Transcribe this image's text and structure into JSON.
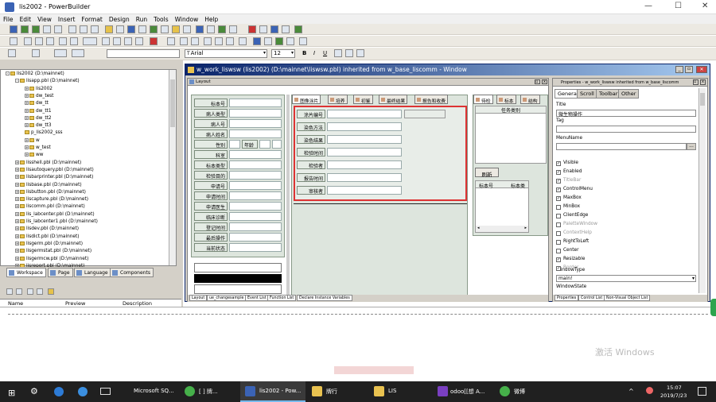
{
  "app": {
    "title": "lis2002 - PowerBuilder"
  },
  "menu": [
    "File",
    "Edit",
    "View",
    "Insert",
    "Format",
    "Design",
    "Run",
    "Tools",
    "Window",
    "Help"
  ],
  "font": {
    "name": "Arial",
    "size": "12",
    "bold": "B",
    "italic": "I",
    "underline": "U"
  },
  "tree": {
    "nodes": [
      {
        "label": "lis2002 (D:\\mainnet)",
        "depth": 0,
        "expand": "-"
      },
      {
        "label": "lisapp.pbl (D:\\mainnet)",
        "depth": 1,
        "expand": "-"
      },
      {
        "label": "lis2002",
        "depth": 2,
        "expand": "+"
      },
      {
        "label": "dw_test",
        "depth": 2,
        "expand": "+"
      },
      {
        "label": "dw_tt",
        "depth": 2,
        "expand": "+"
      },
      {
        "label": "dw_tt1",
        "depth": 2,
        "expand": "+"
      },
      {
        "label": "dw_tt2",
        "depth": 2,
        "expand": "+"
      },
      {
        "label": "dw_tt3",
        "depth": 2,
        "expand": "+"
      },
      {
        "label": "p_lis2002_sss",
        "depth": 2,
        "expand": ""
      },
      {
        "label": "w",
        "depth": 2,
        "expand": "+"
      },
      {
        "label": "w_test",
        "depth": 2,
        "expand": "+"
      },
      {
        "label": "ww",
        "depth": 2,
        "expand": "+"
      },
      {
        "label": "lisshell.pbl (D:\\mainnet)",
        "depth": 1,
        "expand": "+"
      },
      {
        "label": "lisautoquery.pbl (D:\\mainnet)",
        "depth": 1,
        "expand": "+"
      },
      {
        "label": "lisbarprinter.pbl (D:\\mainnet)",
        "depth": 1,
        "expand": "+"
      },
      {
        "label": "lisbase.pbl (D:\\mainnet)",
        "depth": 1,
        "expand": "+"
      },
      {
        "label": "lisbutton.pbl (D:\\mainnet)",
        "depth": 1,
        "expand": "+"
      },
      {
        "label": "liscapture.pbl (D:\\mainnet)",
        "depth": 1,
        "expand": "+"
      },
      {
        "label": "liscomm.pbl (D:\\mainnet)",
        "depth": 1,
        "expand": "+"
      },
      {
        "label": "lis_labcenter.pbl (D:\\mainnet)",
        "depth": 1,
        "expand": "+"
      },
      {
        "label": "lis_labcenter1.pbl (D:\\mainnet)",
        "depth": 1,
        "expand": "+"
      },
      {
        "label": "lisdev.pbl (D:\\mainnet)",
        "depth": 1,
        "expand": "+"
      },
      {
        "label": "lisdict.pbl (D:\\mainnet)",
        "depth": 1,
        "expand": "+"
      },
      {
        "label": "lisgerm.pbl (D:\\mainnet)",
        "depth": 1,
        "expand": "+"
      },
      {
        "label": "lisgermstat.pbl (D:\\mainnet)",
        "depth": 1,
        "expand": "+"
      },
      {
        "label": "lisgermcw.pbl (D:\\mainnet)",
        "depth": 1,
        "expand": "+"
      },
      {
        "label": "lisreport.pbl (D:\\mainnet)",
        "depth": 1,
        "expand": "+"
      }
    ]
  },
  "bottom_tabs": [
    "Workspace",
    "Page",
    "Language",
    "Components"
  ],
  "lib_cols": [
    "Name",
    "Preview",
    "Description"
  ],
  "window": {
    "title": "w_work_liswsw (lis2002) (D:\\mainnet\\liswsw.pbl) inherited from w_base_liscomm - Window",
    "layout_title": "Layout",
    "left_labels": [
      "标本号",
      "病人类型",
      "病人号",
      "病人姓名",
      "性别",
      "科室",
      "标本类型",
      "检验目的",
      "申请号",
      "申请时间",
      "申请医生",
      "临床诊断",
      "登记时间",
      "最后操作",
      "当前状态"
    ],
    "age_label": "年龄",
    "tabs": [
      "图像涂片",
      "培养",
      "初鉴",
      "最终结果",
      "报告和收费"
    ],
    "mid_labels": [
      "涂片编号",
      "染色方法",
      "染色结果",
      "检验时间",
      "检验者",
      "报告时间",
      "审核者"
    ],
    "right_tabs": [
      "待检",
      "标本",
      "结构"
    ],
    "right_col": "任务类别",
    "refresh": "刷新",
    "grid_cols": [
      "标本号",
      "标本类"
    ],
    "bottom_tabs": [
      "Layout",
      "ue_changesample",
      "Event List",
      "Function List",
      "Declare Instance Variables"
    ]
  },
  "props": {
    "title": "Properties - w_work_liswsw inherited from w_base_liscomm",
    "tabs": [
      "General",
      "Scroll",
      "Toolbar",
      "Other"
    ],
    "title_label": "Title",
    "title_value": "微生物操作",
    "tag_label": "Tag",
    "menu_label": "MenuName",
    "checks": [
      {
        "label": "Visible",
        "checked": true,
        "enabled": true
      },
      {
        "label": "Enabled",
        "checked": true,
        "enabled": true
      },
      {
        "label": "TitleBar",
        "checked": true,
        "enabled": false
      },
      {
        "label": "ControlMenu",
        "checked": true,
        "enabled": true
      },
      {
        "label": "MaxBox",
        "checked": true,
        "enabled": true
      },
      {
        "label": "MinBox",
        "checked": false,
        "enabled": true
      },
      {
        "label": "ClientEdge",
        "checked": false,
        "enabled": true
      },
      {
        "label": "PaletteWindow",
        "checked": false,
        "enabled": false
      },
      {
        "label": "ContextHelp",
        "checked": false,
        "enabled": false
      },
      {
        "label": "RightToLeft",
        "checked": false,
        "enabled": true
      },
      {
        "label": "Center",
        "checked": false,
        "enabled": true
      },
      {
        "label": "Resizable",
        "checked": true,
        "enabled": true
      },
      {
        "label": "Border",
        "checked": true,
        "enabled": false
      }
    ],
    "wtype_label": "WindowType",
    "wtype_value": "main!",
    "wstate_label": "WindowState",
    "bottom_tabs": [
      "Properties",
      "Control List",
      "Non-Visual Object List"
    ]
  },
  "watermark": "激活 Windows",
  "taskbar": {
    "items": [
      "Microsoft SQ...",
      "[ ] 牌...",
      "lis2002 - Pow...",
      "牌行",
      "LIS",
      "odoo[[想  A...",
      "微博"
    ],
    "time": "15:07",
    "date": "2019/7/23"
  }
}
